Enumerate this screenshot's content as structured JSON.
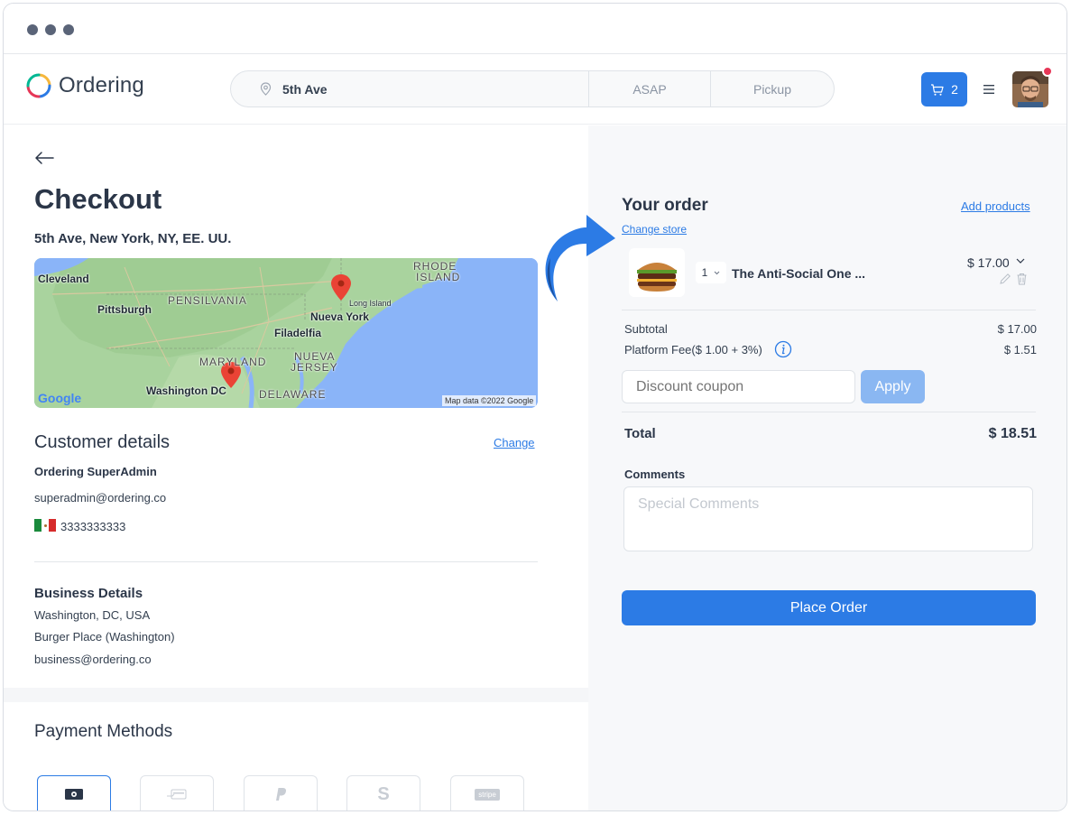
{
  "app": {
    "name": "Ordering"
  },
  "header": {
    "address": "5th Ave",
    "time": "ASAP",
    "order_type": "Pickup",
    "cart_count": "2"
  },
  "checkout": {
    "title": "Checkout",
    "address": "5th Ave, New York, NY, EE. UU."
  },
  "map": {
    "labels": {
      "cleveland": "Cleveland",
      "pittsburgh": "Pittsburgh",
      "pensilvania": "PENSILVANIA",
      "rhode_island_1": "RHODE",
      "rhode_island_2": "ISLAND",
      "long_island": "Long Island",
      "nueva_york": "Nueva York",
      "filadelfia": "Filadelfia",
      "maryland": "MARYLAND",
      "nueva_jersey_1": "NUEVA",
      "nueva_jersey_2": "JERSEY",
      "washington": "Washington DC",
      "delaware": "DELAWARE"
    },
    "google": "Google",
    "credit": "Map data ©2022 Google"
  },
  "customer": {
    "title": "Customer details",
    "change_label": "Change",
    "name": "Ordering SuperAdmin",
    "email": "superadmin@ordering.co",
    "phone": "3333333333"
  },
  "business": {
    "title": "Business Details",
    "location": "Washington, DC, USA",
    "name": "Burger Place (Washington)",
    "email": "business@ordering.co"
  },
  "payment": {
    "title": "Payment Methods",
    "methods": [
      "cash-icon",
      "card-delivery-icon",
      "paypal-icon",
      "square-icon",
      "stripe-icon"
    ],
    "stripe_label": "stripe"
  },
  "order": {
    "title": "Your order",
    "add_products": "Add products",
    "change_store": "Change store",
    "item": {
      "qty": "1",
      "name": "The Anti-Social One ...",
      "price": "$ 17.00"
    },
    "subtotal_label": "Subtotal",
    "subtotal_value": "$ 17.00",
    "fee_label": "Platform Fee($ 1.00 + 3%)",
    "fee_value": "$ 1.51",
    "coupon_placeholder": "Discount coupon",
    "apply_label": "Apply",
    "total_label": "Total",
    "total_value": "$ 18.51",
    "comments_label": "Comments",
    "comments_placeholder": "Special Comments",
    "place_order_label": "Place Order"
  },
  "colors": {
    "primary": "#2c7be5",
    "primary_light": "#8ab7f2",
    "badge": "#e63757",
    "text": "#344050"
  }
}
